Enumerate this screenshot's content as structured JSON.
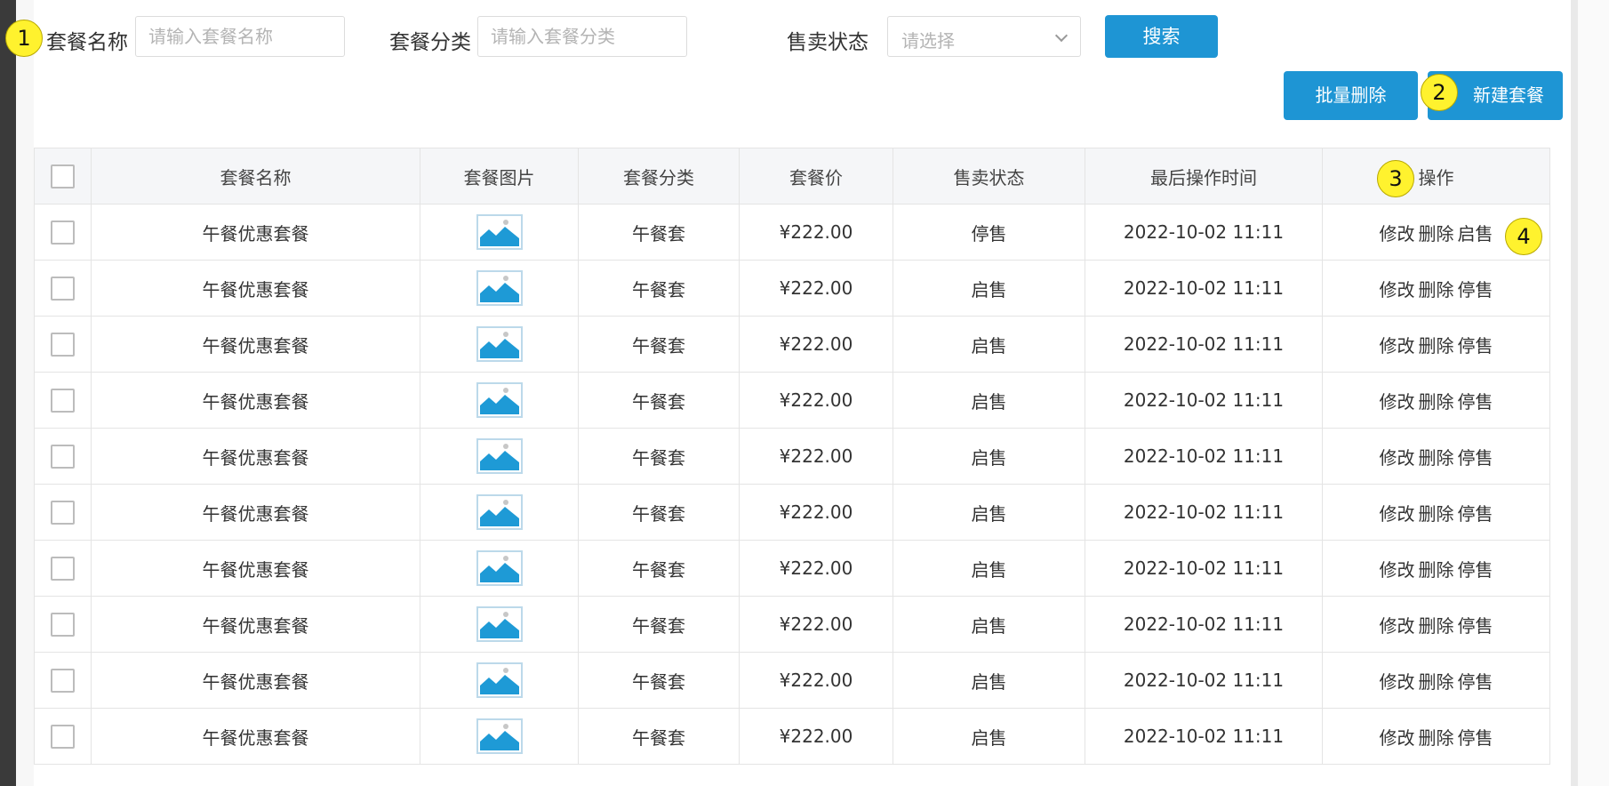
{
  "search": {
    "name_label": "套餐名称",
    "name_placeholder": "请输入套餐名称",
    "category_label": "套餐分类",
    "category_placeholder": "请输入套餐分类",
    "status_label": "售卖状态",
    "status_placeholder": "请选择",
    "search_button": "搜索"
  },
  "actions": {
    "batch_delete": "批量删除",
    "new_combo": "新建套餐"
  },
  "annotations": [
    "1",
    "2",
    "3",
    "4"
  ],
  "table": {
    "headers": [
      "套餐名称",
      "套餐图片",
      "套餐分类",
      "套餐价",
      "售卖状态",
      "最后操作时间",
      "操作"
    ],
    "op_edit": "修改",
    "op_delete": "删除",
    "rows": [
      {
        "name": "午餐优惠套餐",
        "image": "image-icon",
        "category": "午餐套",
        "price": "¥222.00",
        "status": "停售",
        "time": "2022-10-02 11:11",
        "toggle": "启售"
      },
      {
        "name": "午餐优惠套餐",
        "image": "image-icon",
        "category": "午餐套",
        "price": "¥222.00",
        "status": "启售",
        "time": "2022-10-02 11:11",
        "toggle": "停售"
      },
      {
        "name": "午餐优惠套餐",
        "image": "image-icon",
        "category": "午餐套",
        "price": "¥222.00",
        "status": "启售",
        "time": "2022-10-02 11:11",
        "toggle": "停售"
      },
      {
        "name": "午餐优惠套餐",
        "image": "image-icon",
        "category": "午餐套",
        "price": "¥222.00",
        "status": "启售",
        "time": "2022-10-02 11:11",
        "toggle": "停售"
      },
      {
        "name": "午餐优惠套餐",
        "image": "image-icon",
        "category": "午餐套",
        "price": "¥222.00",
        "status": "启售",
        "time": "2022-10-02 11:11",
        "toggle": "停售"
      },
      {
        "name": "午餐优惠套餐",
        "image": "image-icon",
        "category": "午餐套",
        "price": "¥222.00",
        "status": "启售",
        "time": "2022-10-02 11:11",
        "toggle": "停售"
      },
      {
        "name": "午餐优惠套餐",
        "image": "image-icon",
        "category": "午餐套",
        "price": "¥222.00",
        "status": "启售",
        "time": "2022-10-02 11:11",
        "toggle": "停售"
      },
      {
        "name": "午餐优惠套餐",
        "image": "image-icon",
        "category": "午餐套",
        "price": "¥222.00",
        "status": "启售",
        "time": "2022-10-02 11:11",
        "toggle": "停售"
      },
      {
        "name": "午餐优惠套餐",
        "image": "image-icon",
        "category": "午餐套",
        "price": "¥222.00",
        "status": "启售",
        "time": "2022-10-02 11:11",
        "toggle": "停售"
      },
      {
        "name": "午餐优惠套餐",
        "image": "image-icon",
        "category": "午餐套",
        "price": "¥222.00",
        "status": "启售",
        "time": "2022-10-02 11:11",
        "toggle": "停售"
      }
    ]
  },
  "colors": {
    "primary": "#1e95d4",
    "image_icon": "#1e9ad6",
    "badge": "#fff22e"
  }
}
